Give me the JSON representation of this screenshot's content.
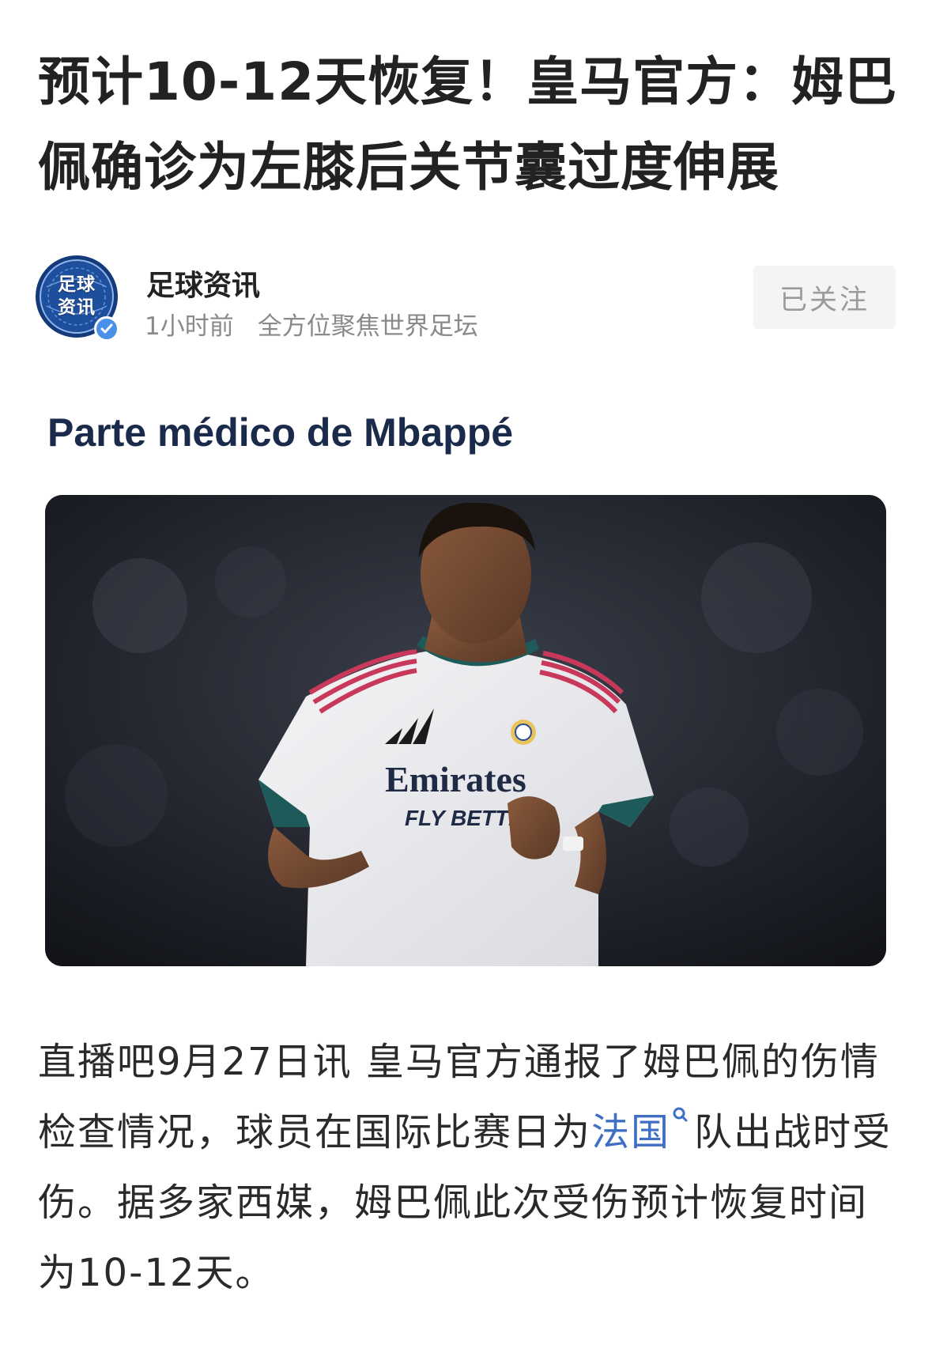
{
  "article": {
    "title": "预计10-12天恢复！皇马官方：姆巴佩确诊为左膝后关节囊过度伸展"
  },
  "author": {
    "avatar_text_line1": "足球",
    "avatar_text_line2": "资讯",
    "name": "足球资讯",
    "time": "1小时前",
    "description": "全方位聚焦世界足坛",
    "follow_label": "已关注",
    "verified": true
  },
  "image": {
    "caption": "Parte médico de Mbappé",
    "jersey_sponsor": "Emirates",
    "jersey_slogan": "FLY BETTER"
  },
  "body": {
    "text_before_link": "直播吧9月27日讯 皇马官方通报了姆巴佩的伤情检查情况，球员在国际比赛日为",
    "link_text": "法国",
    "text_after_link": "队出战时受伤。据多家西媒，姆巴佩此次受伤预计恢复时间为10-12天。"
  },
  "colors": {
    "link": "#3f6fc4",
    "verified_badge": "#4a90e8",
    "avatar_ring": "#1e4f9c",
    "follow_bg": "#f3f4f6",
    "caption": "#1a2a4a"
  }
}
